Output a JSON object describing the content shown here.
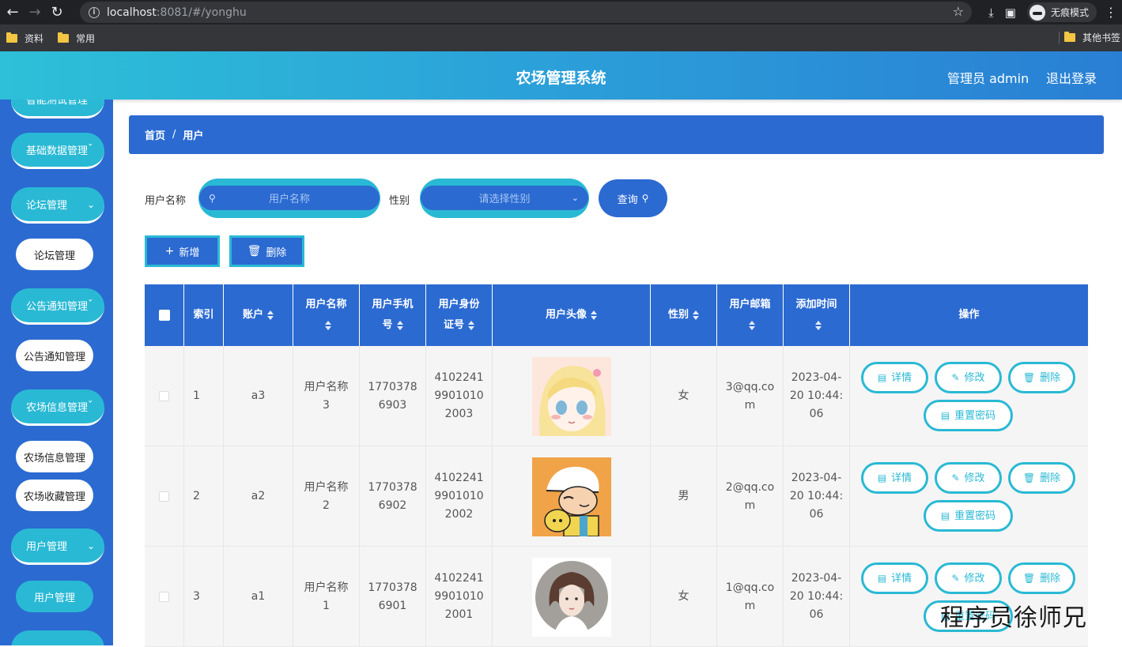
{
  "browser": {
    "url_host": "localhost",
    "url_rest": ":8081/#/yonghu",
    "incognito_label": "无痕模式",
    "bookmarks": [
      "资料",
      "常用"
    ],
    "other_bookmarks": "其他书签"
  },
  "header": {
    "title": "农场管理系统",
    "admin": "管理员 admin",
    "logout": "退出登录"
  },
  "sidebar": {
    "partial_top": "智能测试管理",
    "groups": [
      {
        "label": "基础数据管理",
        "suffix": "ˇ"
      },
      {
        "label": "论坛管理",
        "chevron": "⌄"
      },
      {
        "label": "论坛管理"
      },
      {
        "label": "公告通知管理",
        "suffix": "ˇ"
      },
      {
        "label": "公告通知管理"
      },
      {
        "label": "农场信息管理",
        "suffix": "ˇ"
      },
      {
        "label": "农场信息管理"
      },
      {
        "label": "农场收藏管理"
      },
      {
        "label": "用户管理",
        "chevron": "⌄"
      },
      {
        "label": "用户管理"
      }
    ]
  },
  "breadcrumb": {
    "home": "首页",
    "separator": "/",
    "current": "用户"
  },
  "filters": {
    "username_label": "用户名称",
    "username_placeholder": "用户名称",
    "gender_label": "性别",
    "gender_placeholder": "请选择性别",
    "search_button": "查询"
  },
  "actions": {
    "add": "新增",
    "delete": "删除"
  },
  "table": {
    "headers": {
      "index": "索引",
      "account": "账户",
      "name_1": "用户名称",
      "phone_1": "用户手机",
      "phone_2": "号",
      "idcard_1": "用户身份",
      "idcard_2": "证号",
      "avatar": "用户头像",
      "gender": "性别",
      "email": "用户邮箱",
      "time": "添加时间",
      "ops": "操作"
    },
    "rows": [
      {
        "index": "1",
        "account": "a3",
        "name": [
          "用户名称",
          "3"
        ],
        "phone": [
          "1770378",
          "6903"
        ],
        "idcard": [
          "4102241",
          "9901010",
          "2003"
        ],
        "gender": "女",
        "email": [
          "3@qq.co",
          "m"
        ],
        "time": [
          "2023-04-",
          "20 10:44:",
          "06"
        ]
      },
      {
        "index": "2",
        "account": "a2",
        "name": [
          "用户名称",
          "2"
        ],
        "phone": [
          "1770378",
          "6902"
        ],
        "idcard": [
          "4102241",
          "9901010",
          "2002"
        ],
        "gender": "男",
        "email": [
          "2@qq.co",
          "m"
        ],
        "time": [
          "2023-04-",
          "20 10:44:",
          "06"
        ]
      },
      {
        "index": "3",
        "account": "a1",
        "name": [
          "用户名称",
          "1"
        ],
        "phone": [
          "1770378",
          "6901"
        ],
        "idcard": [
          "4102241",
          "9901010",
          "2001"
        ],
        "gender": "女",
        "email": [
          "1@qq.co",
          "m"
        ],
        "time": [
          "2023-04-",
          "20 10:44:",
          "06"
        ]
      }
    ],
    "row_buttons": {
      "detail": "详情",
      "edit": "修改",
      "delete": "删除",
      "reset": "重置密码"
    }
  },
  "watermark": "程序员徐师兄"
}
